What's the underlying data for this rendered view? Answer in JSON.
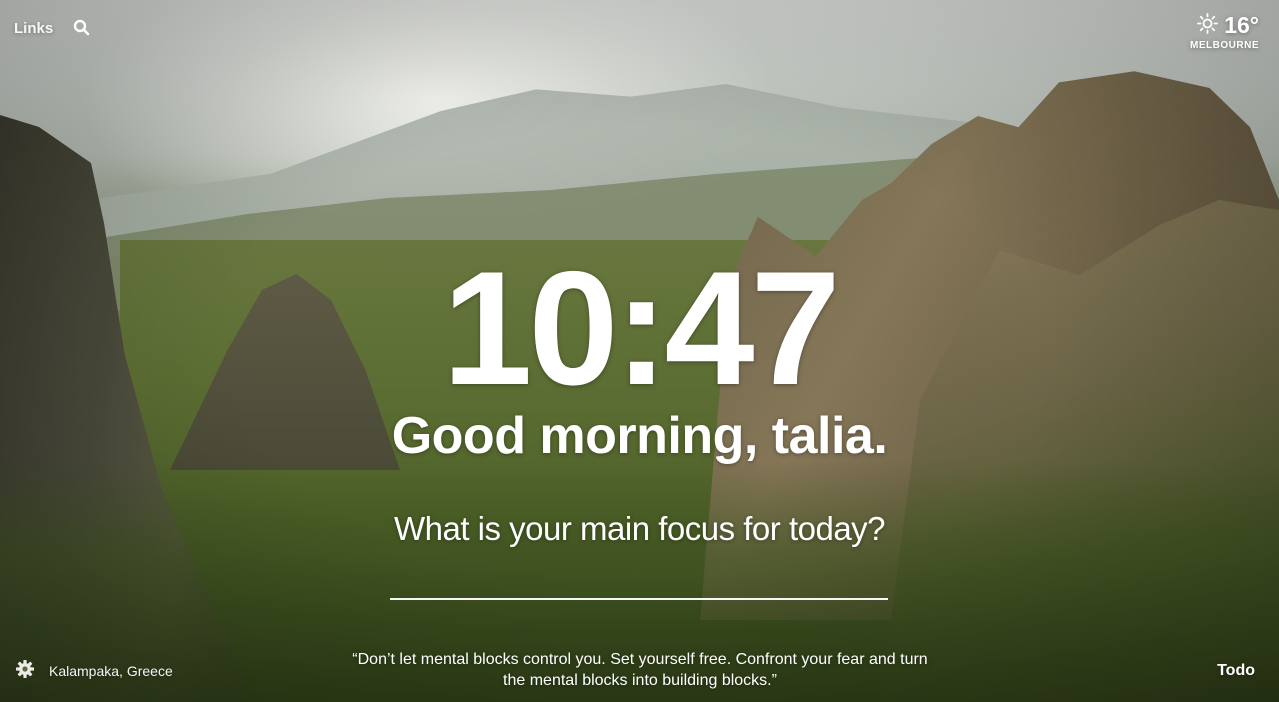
{
  "top_left": {
    "links_label": "Links",
    "search_icon": "search-icon"
  },
  "weather": {
    "icon": "sun-icon",
    "temperature": "16°",
    "city": "MELBOURNE"
  },
  "clock": {
    "time": "10:47"
  },
  "greeting": {
    "text": "Good morning, talia."
  },
  "focus": {
    "prompt": "What is your main focus for today?",
    "value": "",
    "placeholder": ""
  },
  "bottom_left": {
    "settings_icon": "gear-icon",
    "location": "Kalampaka, Greece"
  },
  "quote": {
    "line1": "“Don’t let mental blocks control you. Set yourself free. Confront your fear and turn",
    "line2": "the mental blocks into building blocks.”"
  },
  "todo": {
    "label": "Todo"
  },
  "colors": {
    "text": "#ffffff"
  }
}
